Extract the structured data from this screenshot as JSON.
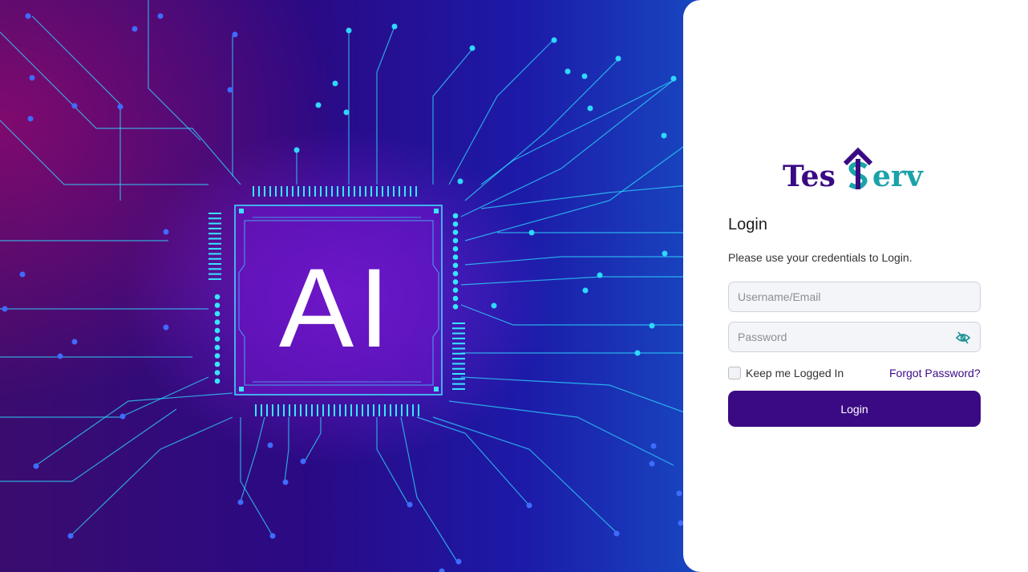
{
  "hero": {
    "chip_text": "AI",
    "colors": {
      "trace": "#2fd8ff",
      "purple": "#7a2cff",
      "magenta": "#a0137a"
    }
  },
  "brand": {
    "name": "TesServ",
    "text_left": "Tes",
    "text_right": "erv",
    "colors": {
      "primary": "#3a0a84",
      "accent": "#1aa3a8"
    }
  },
  "login": {
    "title": "Login",
    "subtitle": "Please use your credentials to Login.",
    "username_placeholder": "Username/Email",
    "password_placeholder": "Password",
    "password_toggle_icon": "eye-slash-icon",
    "remember_label": "Keep me Logged In",
    "forgot_label": "Forgot Password?",
    "submit_label": "Login"
  }
}
